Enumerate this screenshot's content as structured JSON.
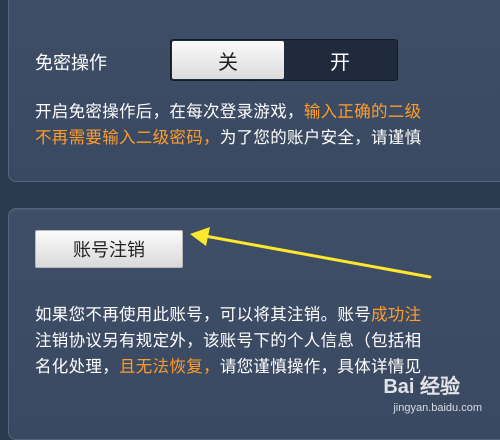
{
  "security": {
    "label": "免密操作",
    "toggle": {
      "off_label": "关",
      "on_label": "开",
      "selected": "关"
    },
    "desc_line1_a": "开启免密操作后，在每次登录游戏，",
    "desc_line1_b": "输入正确的二级",
    "desc_line2_a": "不再需要输入二级密码，",
    "desc_line2_b": "为了您的账户安全，请谨慎"
  },
  "account": {
    "cancel_button": "账号注销",
    "info_line1_a": "如果您不再使用此账号，可以将其注销。账号",
    "info_line1_b": "成功注",
    "info_line2": "注销协议另有规定外，该账号下的个人信息（包括相",
    "info_line3_a": "名化处理，",
    "info_line3_b": "且无法恢复，",
    "info_line3_c": "请您谨慎操作，具体详情见"
  },
  "watermark": {
    "logo": "Bai 经验",
    "url": "jingyan.baidu.com"
  },
  "colors": {
    "highlight": "#ff9c2a",
    "arrow": "#ffe72b",
    "panel": "#3d4c65",
    "background": "#2c3a50"
  }
}
